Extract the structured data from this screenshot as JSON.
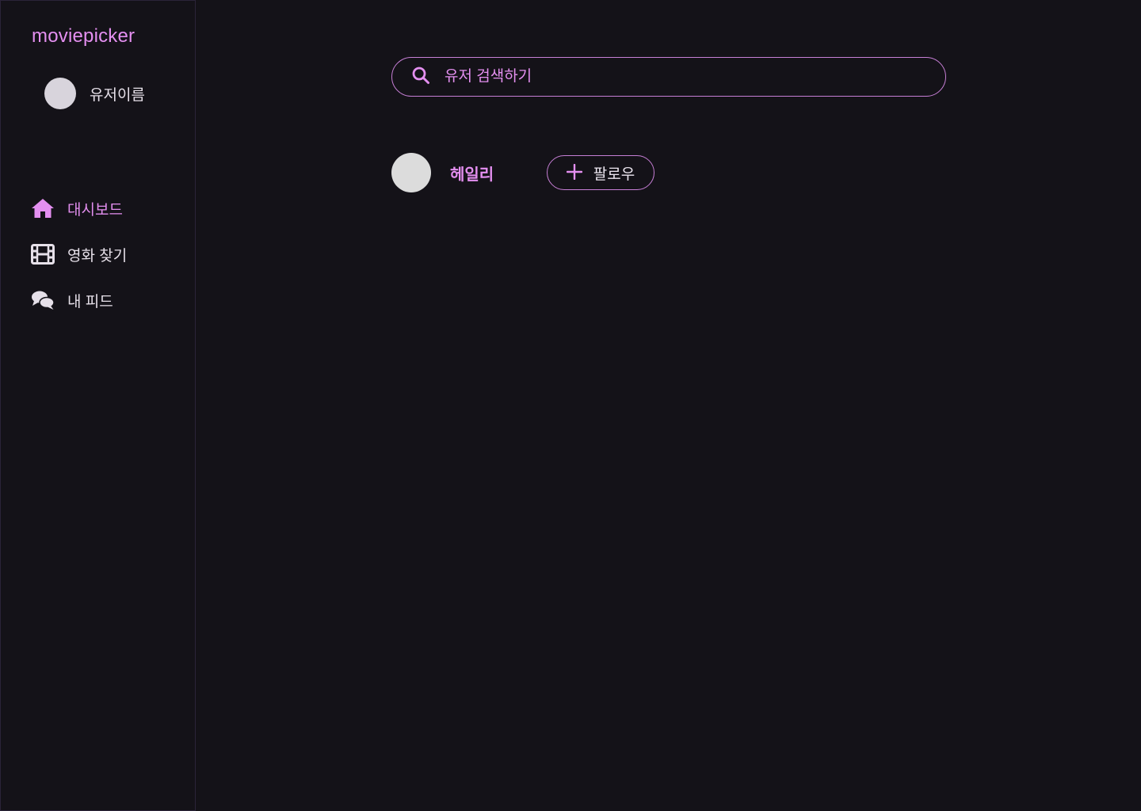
{
  "app": {
    "logo": "moviepicker"
  },
  "sidebar": {
    "profile": {
      "username": "유저이름"
    },
    "items": [
      {
        "label": "대시보드",
        "icon": "home-icon",
        "active": true
      },
      {
        "label": "영화 찾기",
        "icon": "film-icon",
        "active": false
      },
      {
        "label": "내 피드",
        "icon": "chat-icon",
        "active": false
      }
    ]
  },
  "search": {
    "placeholder": "유저 검색하기",
    "value": ""
  },
  "results": [
    {
      "name": "헤일리",
      "follow_label": "팔로우"
    }
  ],
  "colors": {
    "background": "#141218",
    "accent": "#e48ff0",
    "text": "#e6e0e9",
    "avatar": "#dcdcdc"
  }
}
